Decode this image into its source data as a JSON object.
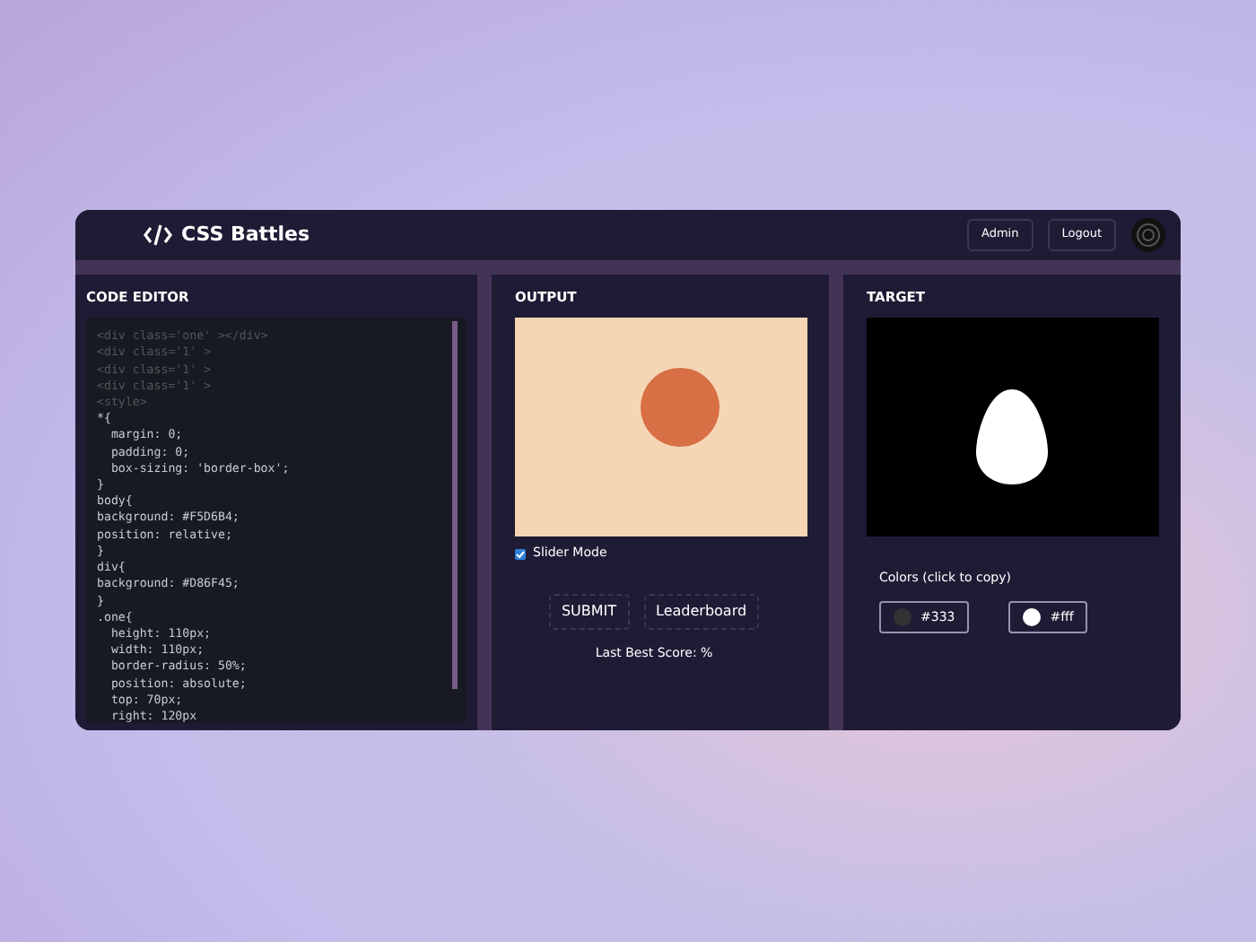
{
  "navbar": {
    "logo_text": "CSS Battles",
    "buttons": [
      "Admin",
      "Logout"
    ]
  },
  "code_editor": {
    "title": "CODE EDITOR",
    "lines": [
      {
        "kind": "markup",
        "text": "<div class='one' ></div>"
      },
      {
        "kind": "markup",
        "text": "<div class='1' >"
      },
      {
        "kind": "markup",
        "text": "<div class='1' >"
      },
      {
        "kind": "markup",
        "text": "<div class='1' >"
      },
      {
        "kind": "markup",
        "text": "<style>"
      },
      {
        "kind": "css",
        "text": "*{"
      },
      {
        "kind": "css",
        "text": "  margin: 0;"
      },
      {
        "kind": "css",
        "text": "  padding: 0;"
      },
      {
        "kind": "css",
        "text": "  box-sizing: 'border-box';"
      },
      {
        "kind": "css",
        "text": "}"
      },
      {
        "kind": "css",
        "text": "body{"
      },
      {
        "kind": "css",
        "text": "background: #F5D6B4;"
      },
      {
        "kind": "css",
        "text": "position: relative;"
      },
      {
        "kind": "css",
        "text": "}"
      },
      {
        "kind": "css",
        "text": "div{"
      },
      {
        "kind": "css",
        "text": "background: #D86F45;"
      },
      {
        "kind": "css",
        "text": "}"
      },
      {
        "kind": "css",
        "text": ".one{"
      },
      {
        "kind": "css",
        "text": "  height: 110px;"
      },
      {
        "kind": "css",
        "text": "  width: 110px;"
      },
      {
        "kind": "css",
        "text": "  border-radius: 50%;"
      },
      {
        "kind": "css",
        "text": "  position: absolute;"
      },
      {
        "kind": "css",
        "text": "  top: 70px;"
      },
      {
        "kind": "css",
        "text": "  right: 120px"
      }
    ]
  },
  "output": {
    "title": "OUTPUT",
    "slider_mode": {
      "label": "Slider Mode",
      "checked": true
    },
    "buttons": [
      "SUBMIT",
      "Leaderboard"
    ],
    "score_text": "Last Best Score: %"
  },
  "target": {
    "title": "TARGET",
    "colors_label": "Colors (click to copy)",
    "colors": [
      {
        "label": "#333",
        "color": "#333333"
      },
      {
        "label": "#fff",
        "color": "#ffffff"
      }
    ]
  }
}
